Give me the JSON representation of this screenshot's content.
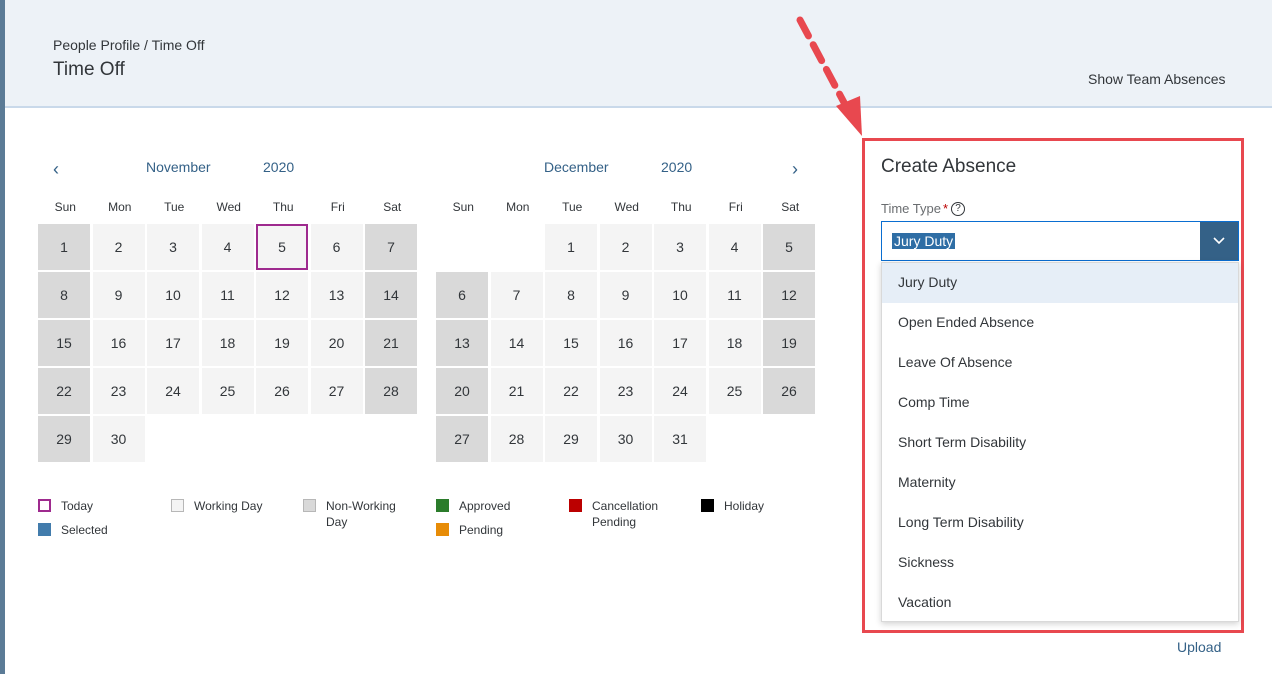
{
  "header": {
    "breadcrumb": "People Profile / Time Off",
    "title": "Time Off",
    "team_link": "Show Team Absences"
  },
  "calendars": [
    {
      "month": "November",
      "year": "2020",
      "weekdays": [
        "Sun",
        "Mon",
        "Tue",
        "Wed",
        "Thu",
        "Fri",
        "Sat"
      ],
      "weeks": [
        [
          "1",
          "2",
          "3",
          "4",
          "5",
          "6",
          "7"
        ],
        [
          "8",
          "9",
          "10",
          "11",
          "12",
          "13",
          "14"
        ],
        [
          "15",
          "16",
          "17",
          "18",
          "19",
          "20",
          "21"
        ],
        [
          "22",
          "23",
          "24",
          "25",
          "26",
          "27",
          "28"
        ],
        [
          "29",
          "30",
          "",
          "",
          "",
          "",
          ""
        ]
      ]
    },
    {
      "month": "December",
      "year": "2020",
      "weekdays": [
        "Sun",
        "Mon",
        "Tue",
        "Wed",
        "Thu",
        "Fri",
        "Sat"
      ],
      "weeks": [
        [
          "",
          "",
          "1",
          "2",
          "3",
          "4",
          "5"
        ],
        [
          "6",
          "7",
          "8",
          "9",
          "10",
          "11",
          "12"
        ],
        [
          "13",
          "14",
          "15",
          "16",
          "17",
          "18",
          "19"
        ],
        [
          "20",
          "21",
          "22",
          "23",
          "24",
          "25",
          "26"
        ],
        [
          "27",
          "28",
          "29",
          "30",
          "31",
          "",
          ""
        ]
      ]
    }
  ],
  "legend": {
    "today": "Today",
    "selected": "Selected",
    "working_day": "Working Day",
    "non_working_day": "Non-Working Day",
    "approved": "Approved",
    "pending": "Pending",
    "cancellation_pending": "Cancellation Pending",
    "holiday": "Holiday"
  },
  "colors": {
    "today": "#9e2a8e",
    "selected": "#427cac",
    "working_day": "#f4f4f4",
    "non_working_day": "#d9d9d9",
    "approved": "#2b7c2b",
    "pending": "#e78c07",
    "cancellation_pending": "#bb0000",
    "holiday": "#000000",
    "annotation": "#e8484f"
  },
  "create_absence": {
    "title": "Create Absence",
    "time_type_label": "Time Type",
    "required_mark": "*",
    "help_icon": "?",
    "selected_value": "Jury Duty",
    "options": [
      "Jury Duty",
      "Open Ended Absence",
      "Leave Of Absence",
      "Comp Time",
      "Short Term Disability",
      "Maternity",
      "Long Term Disability",
      "Sickness",
      "Vacation"
    ]
  },
  "upload_link": "Upload"
}
